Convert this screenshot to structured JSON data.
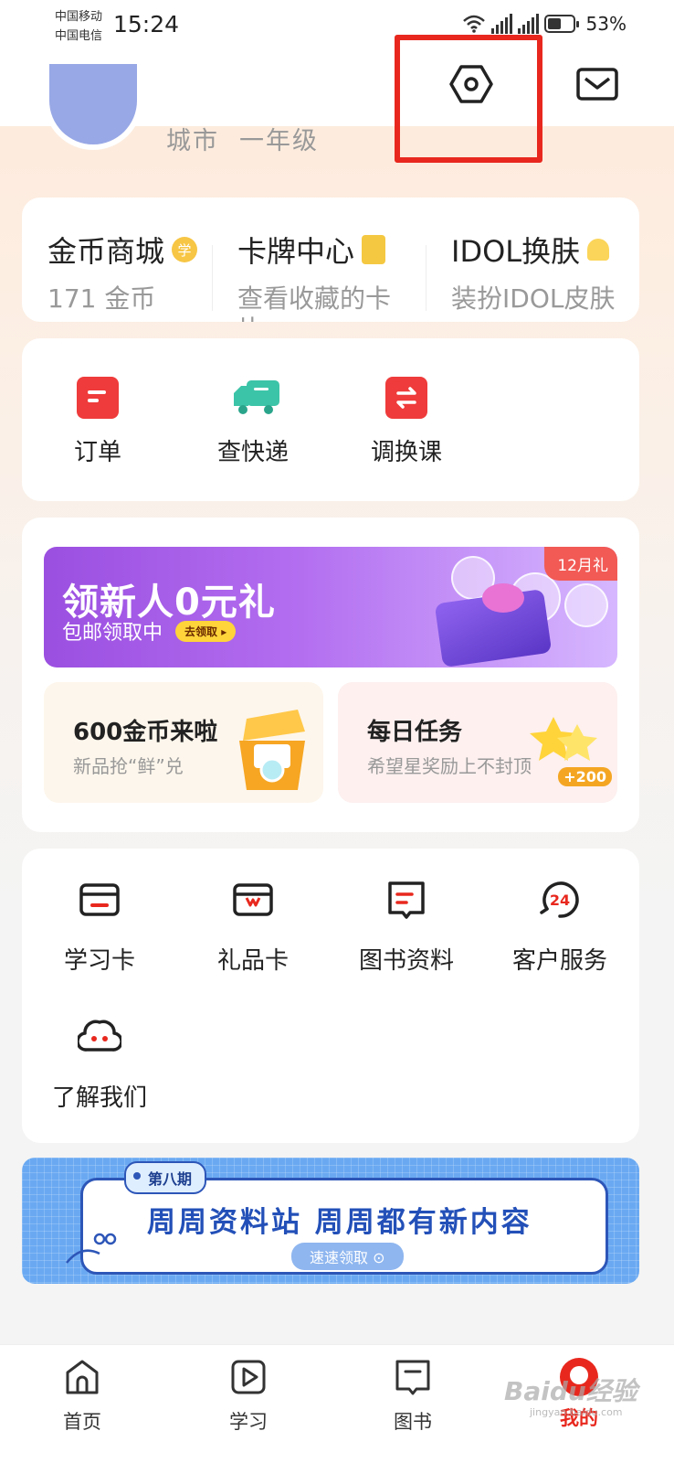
{
  "status_bar": {
    "carrier_1": "中国移动",
    "carrier_2": "中国电信",
    "time": "15:24",
    "battery": "53%"
  },
  "header": {
    "settings_icon": "settings-hexagon-icon",
    "mail_icon": "mail-icon",
    "highlight_color": "#e8281e"
  },
  "profile": {
    "city": "城市",
    "grade": "一年级"
  },
  "quick_links": [
    {
      "title": "金币商城",
      "subtitle": "171 金币",
      "badge": "学"
    },
    {
      "title": "卡牌中心",
      "subtitle": "查看收藏的卡片"
    },
    {
      "title": "IDOL换肤",
      "subtitle": "装扮IDOL皮肤"
    }
  ],
  "orders": [
    {
      "label": "订单",
      "icon": "order-icon",
      "color": "#ef3b3b"
    },
    {
      "label": "查快递",
      "icon": "delivery-truck-icon",
      "color": "#3cc4a8"
    },
    {
      "label": "调换课",
      "icon": "swap-class-icon",
      "color": "#ef3b3b"
    }
  ],
  "promo": {
    "banner_title": "领新人0元礼",
    "banner_sub": "包邮领取中",
    "banner_button": "去领取 ▸",
    "banner_tag": "12月礼",
    "coins_title": "600金币来啦",
    "coins_sub": "新品抢“鲜”兑",
    "daily_title": "每日任务",
    "daily_sub": "希望星奖励上不封顶",
    "daily_badge": "+200"
  },
  "services": [
    {
      "label": "学习卡",
      "icon": "study-card-icon"
    },
    {
      "label": "礼品卡",
      "icon": "gift-card-icon"
    },
    {
      "label": "图书资料",
      "icon": "book-materials-icon"
    },
    {
      "label": "客户服务",
      "icon": "customer-service-24-icon",
      "badge": "24"
    },
    {
      "label": "了解我们",
      "icon": "about-us-cloud-icon"
    }
  ],
  "weekly": {
    "tag": "第八期",
    "title": "周周资料站  周周都有新内容",
    "button": "速速领取 ⊙"
  },
  "tabbar": [
    {
      "label": "首页",
      "icon": "home-icon"
    },
    {
      "label": "学习",
      "icon": "play-icon"
    },
    {
      "label": "图书",
      "icon": "book-icon"
    },
    {
      "label": "我的",
      "icon": "profile-avatar-icon",
      "active": true
    }
  ],
  "watermark": {
    "text": "Baidu经验",
    "sub": "jingyan.baidu.com"
  }
}
